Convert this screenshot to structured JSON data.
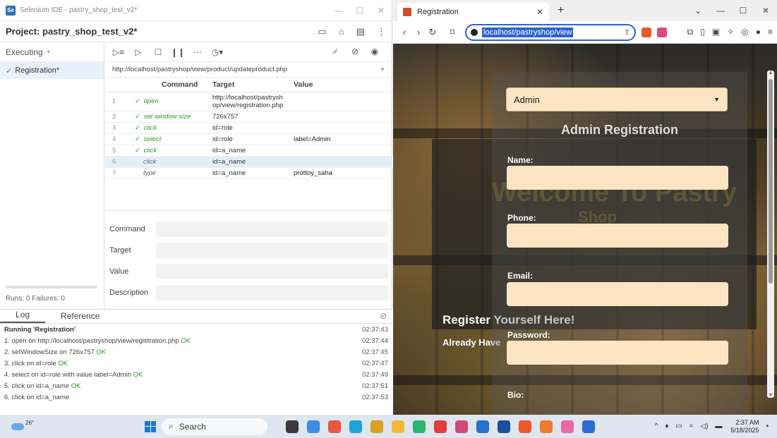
{
  "selenium": {
    "window_title": "Selenium IDE - pastry_shop_test_v2*",
    "project_label": "Project: pastry_shop_test_v2*",
    "executing_label": "Executing",
    "test_name": "Registration*",
    "runs_text": "Runs: 0   Failures: 0",
    "base_url": "http://localhost/pastryshop/view/product/updateproduct.php",
    "headers": {
      "num": "",
      "command": "Command",
      "target": "Target",
      "value": "Value"
    },
    "commands": [
      {
        "num": "1",
        "command": "open",
        "target": "http://localhost/pastrysh op/view/registration.php",
        "value": "",
        "done": true
      },
      {
        "num": "2",
        "command": "set window size",
        "target": "726x757",
        "value": "",
        "done": true
      },
      {
        "num": "3",
        "command": "click",
        "target": "id=role",
        "value": "",
        "done": true
      },
      {
        "num": "4",
        "command": "select",
        "target": "id=role",
        "value": "label=Admin",
        "done": true
      },
      {
        "num": "5",
        "command": "click",
        "target": "id=a_name",
        "value": "",
        "done": true
      },
      {
        "num": "6",
        "command": "click",
        "target": "id=a_name",
        "value": "",
        "done": false
      },
      {
        "num": "7",
        "command": "type",
        "target": "id=a_name",
        "value": "prottoy_saha",
        "done": false
      }
    ],
    "editor": {
      "command": "Command",
      "target": "Target",
      "value": "Value",
      "description": "Description"
    },
    "log_tabs": [
      "Log",
      "Reference"
    ],
    "log": [
      {
        "text": "Running 'Registration'",
        "ok": "",
        "time": "02:37:43",
        "head": true
      },
      {
        "text": "1.  open on http://localhost/pastryshop/view/registration.php ",
        "ok": "OK",
        "time": "02:37:44"
      },
      {
        "text": "2.  setWindowSize on 726x757 ",
        "ok": "OK",
        "time": "02:37:45"
      },
      {
        "text": "3.  click on id=role ",
        "ok": "OK",
        "time": "02:37:47"
      },
      {
        "text": "4.  select on id=role with value label=Admin ",
        "ok": "OK",
        "time": "02:37:49"
      },
      {
        "text": "5.  click on id=a_name ",
        "ok": "OK",
        "time": "02:37:51"
      },
      {
        "text": "6.  click on id=a_name ",
        "ok": "",
        "time": "02:37:53"
      }
    ]
  },
  "browser": {
    "tab_title": "Registration",
    "address": "localhost/pastryshop/view",
    "role_selected": "Admin",
    "admin_title": "Admin Registration",
    "welcome_line1": "Welcome To Pastry",
    "welcome_line2": "Shop",
    "register_text": "Register Yourself Here!",
    "already_text": "Already Have",
    "labels": {
      "name": "Name:",
      "phone": "Phone:",
      "email": "Email:",
      "password": "Password:",
      "bio": "Bio:"
    }
  },
  "taskbar": {
    "weather": "26°",
    "search_label": "Search",
    "time": "2:37 AM",
    "date": "5/18/2025"
  },
  "colors": {
    "accent": "#2d63d6",
    "ok": "#2c9b2c",
    "form_input": "#fde5c4"
  }
}
